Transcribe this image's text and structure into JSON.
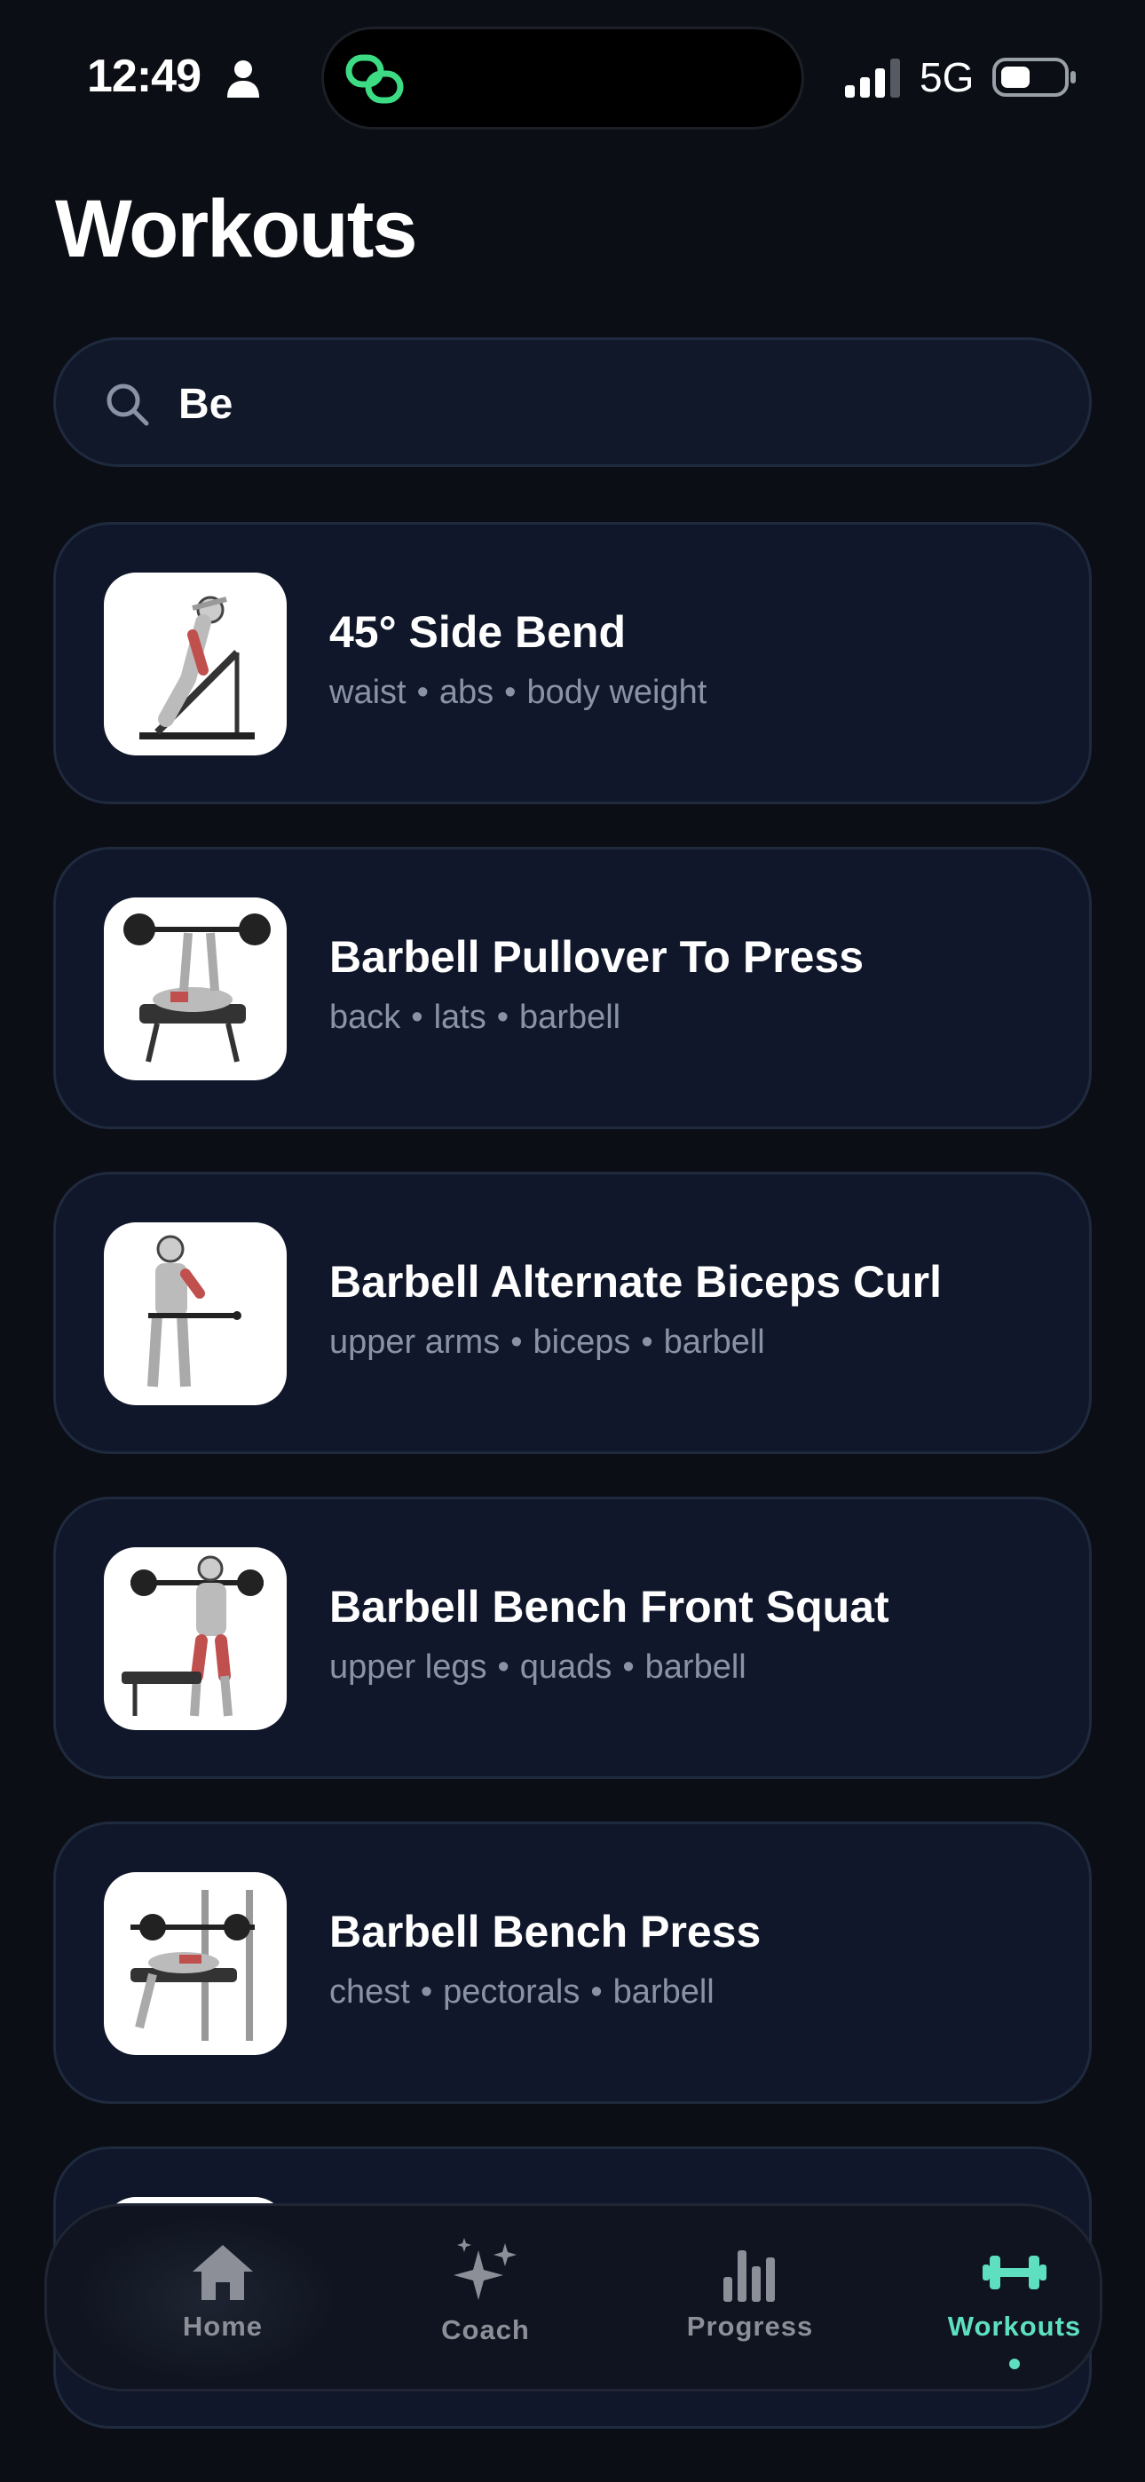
{
  "status_bar": {
    "time": "12:49",
    "network": "5G",
    "icons": [
      "person-icon",
      "chain-link-icon",
      "signal-icon",
      "battery-icon"
    ],
    "island_icon_color": "#3ddc84"
  },
  "page": {
    "title": "Workouts"
  },
  "search": {
    "value": "Be",
    "placeholder": "Search"
  },
  "exercises": [
    {
      "name": "45° Side Bend",
      "body_part": "waist",
      "target": "abs",
      "equipment": "body weight"
    },
    {
      "name": "Barbell Pullover To Press",
      "body_part": "back",
      "target": "lats",
      "equipment": "barbell"
    },
    {
      "name": "Barbell Alternate Biceps Curl",
      "body_part": "upper arms",
      "target": "biceps",
      "equipment": "barbell"
    },
    {
      "name": "Barbell Bench Front Squat",
      "body_part": "upper legs",
      "target": "quads",
      "equipment": "barbell"
    },
    {
      "name": "Barbell Bench Press",
      "body_part": "chest",
      "target": "pectorals",
      "equipment": "barbell"
    }
  ],
  "meta_separator": "•",
  "tab_bar": {
    "tabs": [
      {
        "label": "Home",
        "icon": "home-icon"
      },
      {
        "label": "Coach",
        "icon": "sparkles-icon"
      },
      {
        "label": "Progress",
        "icon": "bar-chart-icon"
      },
      {
        "label": "Workouts",
        "icon": "dumbbell-icon"
      }
    ],
    "active": "Workouts"
  },
  "colors": {
    "background": "#0b0e14",
    "card": "#10172a",
    "card_border": "#1f2a3f",
    "accent": "#5ee0c0",
    "muted_text": "#8a93a6"
  }
}
